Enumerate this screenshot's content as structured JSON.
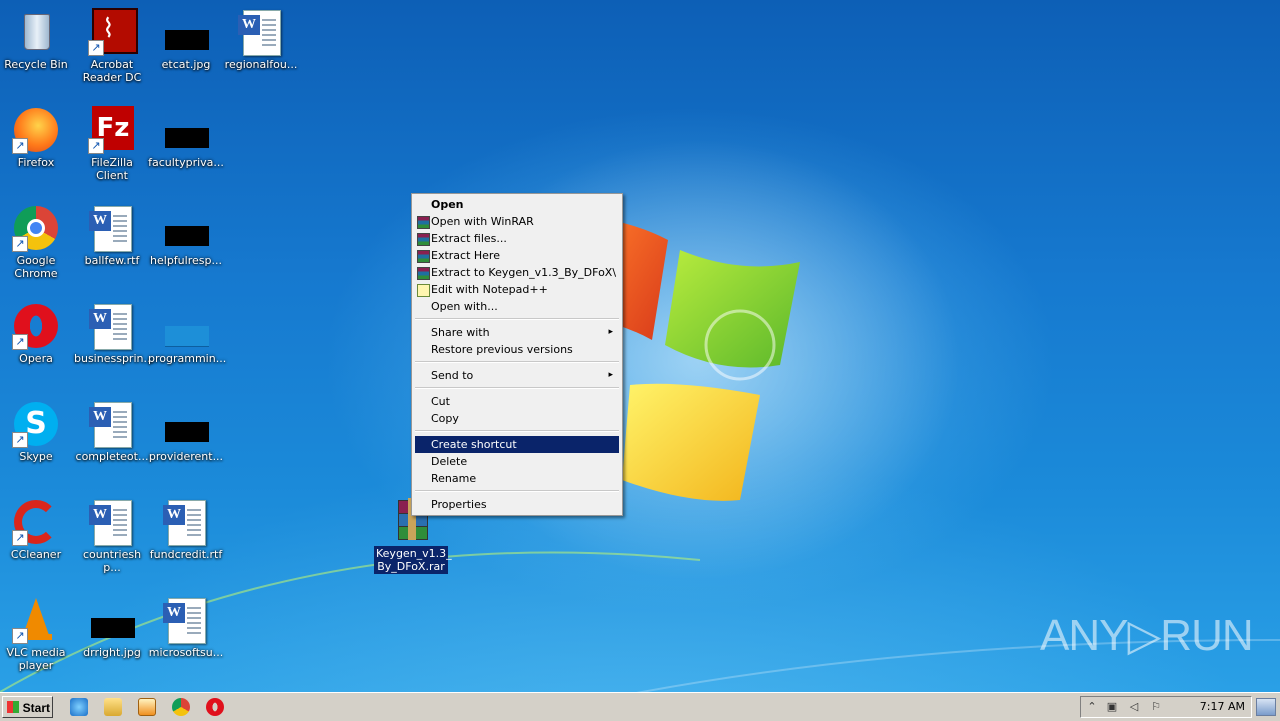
{
  "desktop": {
    "icons": [
      {
        "label": "Recycle Bin",
        "icon": "recycle-bin-icon"
      },
      {
        "label": "Acrobat Reader DC",
        "icon": "acrobat-icon"
      },
      {
        "label": "etcat.jpg",
        "icon": "image-file-icon"
      },
      {
        "label": "regionalfou...",
        "icon": "word-doc-icon"
      },
      {
        "label": "Firefox",
        "icon": "firefox-icon"
      },
      {
        "label": "FileZilla Client",
        "icon": "filezilla-icon"
      },
      {
        "label": "facultypriva...",
        "icon": "image-file-icon"
      },
      {
        "label": "Google Chrome",
        "icon": "chrome-icon"
      },
      {
        "label": "ballfew.rtf",
        "icon": "word-doc-icon"
      },
      {
        "label": "helpfulresp...",
        "icon": "image-file-icon"
      },
      {
        "label": "Opera",
        "icon": "opera-icon"
      },
      {
        "label": "businessprin...",
        "icon": "word-doc-icon"
      },
      {
        "label": "programmin...",
        "icon": "image-file-icon"
      },
      {
        "label": "Skype",
        "icon": "skype-icon"
      },
      {
        "label": "completeot...",
        "icon": "word-doc-icon"
      },
      {
        "label": "providerent...",
        "icon": "image-file-icon"
      },
      {
        "label": "CCleaner",
        "icon": "ccleaner-icon"
      },
      {
        "label": "countriesh p...",
        "icon": "word-doc-icon"
      },
      {
        "label": "fundcredit.rtf",
        "icon": "word-doc-icon"
      },
      {
        "label": "VLC media player",
        "icon": "vlc-icon"
      },
      {
        "label": "drright.jpg",
        "icon": "image-file-icon"
      },
      {
        "label": "microsoftsu...",
        "icon": "word-doc-icon"
      }
    ],
    "selected_file": {
      "label_line1": "Keygen_v1.3_",
      "label_line2": "By_DFoX.rar",
      "icon": "winrar-archive-icon"
    }
  },
  "context_menu": {
    "items": {
      "open": "Open",
      "open_winrar": "Open with WinRAR",
      "extract_files": "Extract files...",
      "extract_here": "Extract Here",
      "extract_to": "Extract to Keygen_v1.3_By_DFoX\\",
      "edit_notepad": "Edit with Notepad++",
      "open_with": "Open with...",
      "share_with": "Share with",
      "restore_versions": "Restore previous versions",
      "send_to": "Send to",
      "cut": "Cut",
      "copy": "Copy",
      "create_shortcut": "Create shortcut",
      "delete": "Delete",
      "rename": "Rename",
      "properties": "Properties"
    },
    "highlighted": "Create shortcut",
    "submenu_arrow": "▸"
  },
  "taskbar": {
    "start_label": "Start",
    "clock": "7:17 AM",
    "pinned": [
      "internet-explorer-icon",
      "explorer-icon",
      "media-player-icon",
      "chrome-icon",
      "opera-icon"
    ]
  },
  "watermark": "ANY▷RUN",
  "colors": {
    "selection": "#0a246a",
    "menu_bg": "#f0f0f0",
    "taskbar_bg": "#d4d0c8"
  }
}
